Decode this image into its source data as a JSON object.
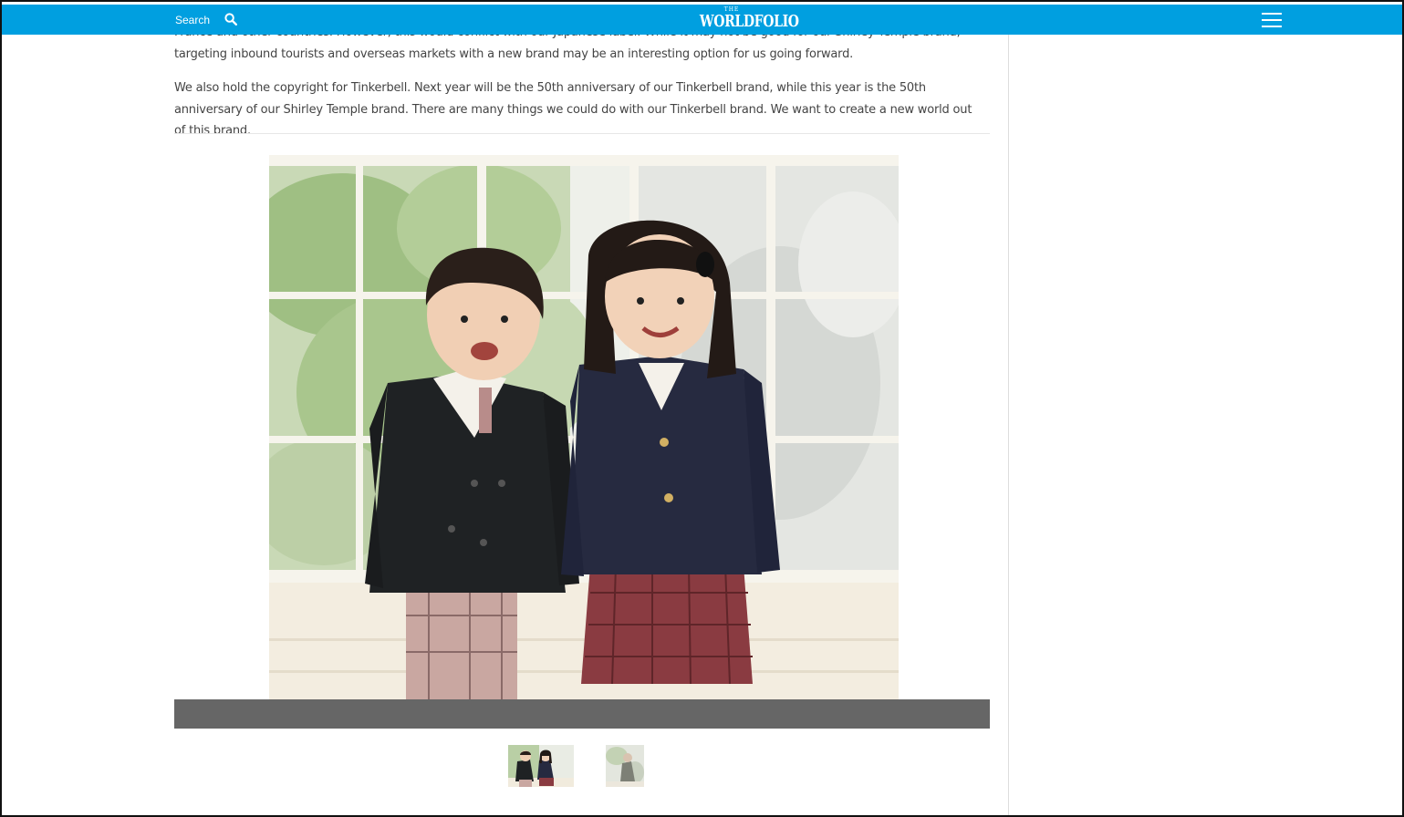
{
  "header": {
    "search_label": "Search",
    "logo_small": "THE",
    "logo_main": "WORLDFOLIO",
    "bar_color": "#009fe0",
    "icons": {
      "search": "search-icon",
      "menu": "hamburger-menu-icon"
    }
  },
  "article": {
    "paragraph_cut": "France and other countries. However, this would conflict with our Japanese label. While it may not be good for our Shirley Temple brand, targeting inbound tourists and overseas markets with a new brand may be an interesting option for us going forward.",
    "paragraph_2": "We also hold the copyright for Tinkerbell. Next year will be the 50th anniversary of our Tinkerbell brand, while this year is the 50th anniversary of our Shirley Temple brand. There are many things we could do with our Tinkerbell brand. We want to create a new world out of this brand."
  },
  "gallery": {
    "caption_bar_color": "#666666",
    "thumbnail_count": 2,
    "selected_index": 0
  }
}
